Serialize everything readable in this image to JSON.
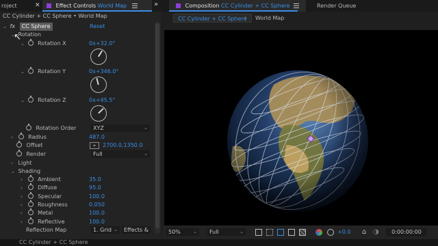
{
  "left_tabs": {
    "project_label": "roject",
    "effect_controls_label": "Effect Controls",
    "effect_controls_layer": "World Map"
  },
  "breadcrumb": "CC Cylinder + CC Sphere • World Map",
  "effect": {
    "fx_label": "fx",
    "name": "CC Sphere",
    "reset_label": "Reset"
  },
  "rotation_group_label": "Rotation",
  "rotation_x": {
    "label": "Rotation X",
    "value": "0x+32.0°",
    "angle": 32.0
  },
  "rotation_y": {
    "label": "Rotation Y",
    "value": "0x+346.0°",
    "angle": 346.0
  },
  "rotation_z": {
    "label": "Rotation Z",
    "value": "0x+45.5°",
    "angle": 45.5
  },
  "rotation_order": {
    "label": "Rotation Order",
    "value": "XYZ"
  },
  "radius": {
    "label": "Radius",
    "value": "487.0"
  },
  "offset": {
    "label": "Offset",
    "value": "2700.0,1350.0"
  },
  "render": {
    "label": "Render",
    "value": "Full"
  },
  "light_label": "Light",
  "shading": {
    "label": "Shading",
    "ambient": {
      "label": "Ambient",
      "value": "35.0"
    },
    "diffuse": {
      "label": "Diffuse",
      "value": "95.0"
    },
    "specular": {
      "label": "Specular",
      "value": "100.0"
    },
    "roughness": {
      "label": "Roughness",
      "value": "0.050"
    },
    "metal": {
      "label": "Metal",
      "value": "100.0"
    },
    "reflective": {
      "label": "Reflective",
      "value": "100.0"
    },
    "reflection_map": {
      "label": "Reflection Map",
      "value": "1. Grid",
      "extra": "Effects &"
    }
  },
  "right_tabs": {
    "composition_label": "Composition",
    "composition_name": "CC Cylinder + CC Sphere",
    "render_queue_label": "Render Queue"
  },
  "viewer_breadcrumb": {
    "comp": "CC Cylinder + CC Sphere",
    "layer": "World Map"
  },
  "viewer_toolbar": {
    "zoom": "50%",
    "resolution": "Full",
    "exposure": "+0.0",
    "timecode": "0:00:00:00"
  },
  "bottom_strip_text": "CC Cylinder + CC Sphere",
  "colors": {
    "accent": "#3a8ee6",
    "label_purple": "#8b3fd9",
    "selected_gray": "#5a5a5a"
  }
}
